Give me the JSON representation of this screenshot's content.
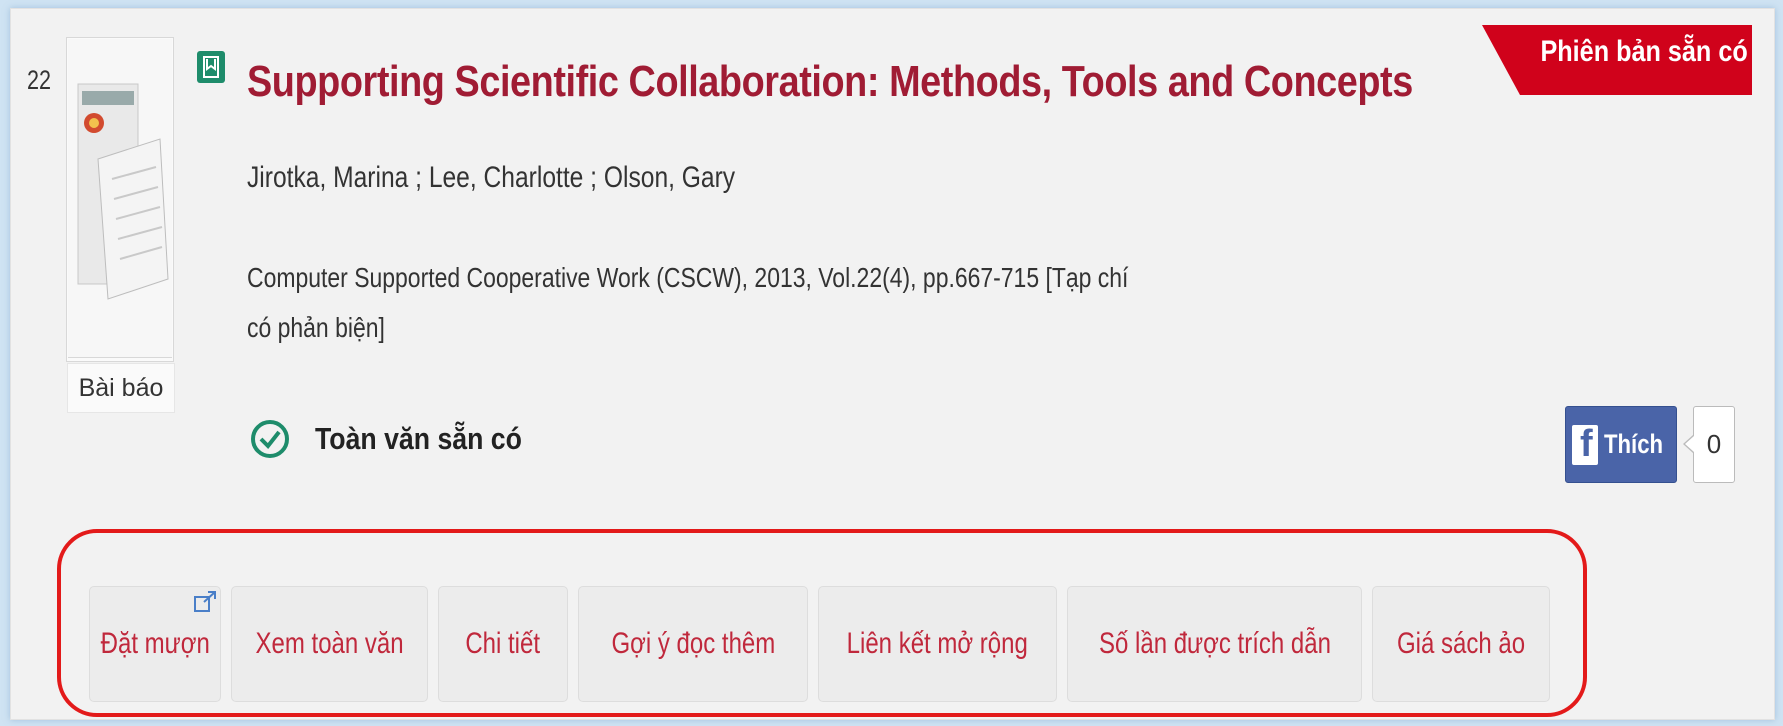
{
  "record": {
    "number": "22",
    "type_label": "Bài báo",
    "title": "Supporting Scientific Collaboration: Methods, Tools and Concepts",
    "authors": "Jirotka, Marina ; Lee, Charlotte ; Olson, Gary",
    "source": "Computer Supported Cooperative Work (CSCW), 2013, Vol.22(4), pp.667-715 [Tạp chí có phản biện]",
    "fulltext_status": "Toàn văn sẵn có",
    "availability_badge": "Phiên bản sẵn có"
  },
  "social": {
    "like_label": "Thích",
    "like_count": "0"
  },
  "actions": [
    {
      "label": "Đặt mượn"
    },
    {
      "label": "Xem toàn văn"
    },
    {
      "label": "Chi tiết"
    },
    {
      "label": "Gợi ý đọc thêm"
    },
    {
      "label": "Liên kết mở rộng"
    },
    {
      "label": "Số lần được trích dẫn"
    },
    {
      "label": "Giá sách ảo"
    }
  ],
  "colors": {
    "title": "#a01c34",
    "badge": "#d0021b",
    "check": "#1e8c6b",
    "action_text": "#c0283c",
    "highlight": "#e31a1a",
    "facebook": "#4a64a8"
  },
  "icons": [
    "document-thumbnail-icon",
    "bookmark-icon",
    "check-circle-icon",
    "facebook-icon",
    "external-link-icon"
  ]
}
